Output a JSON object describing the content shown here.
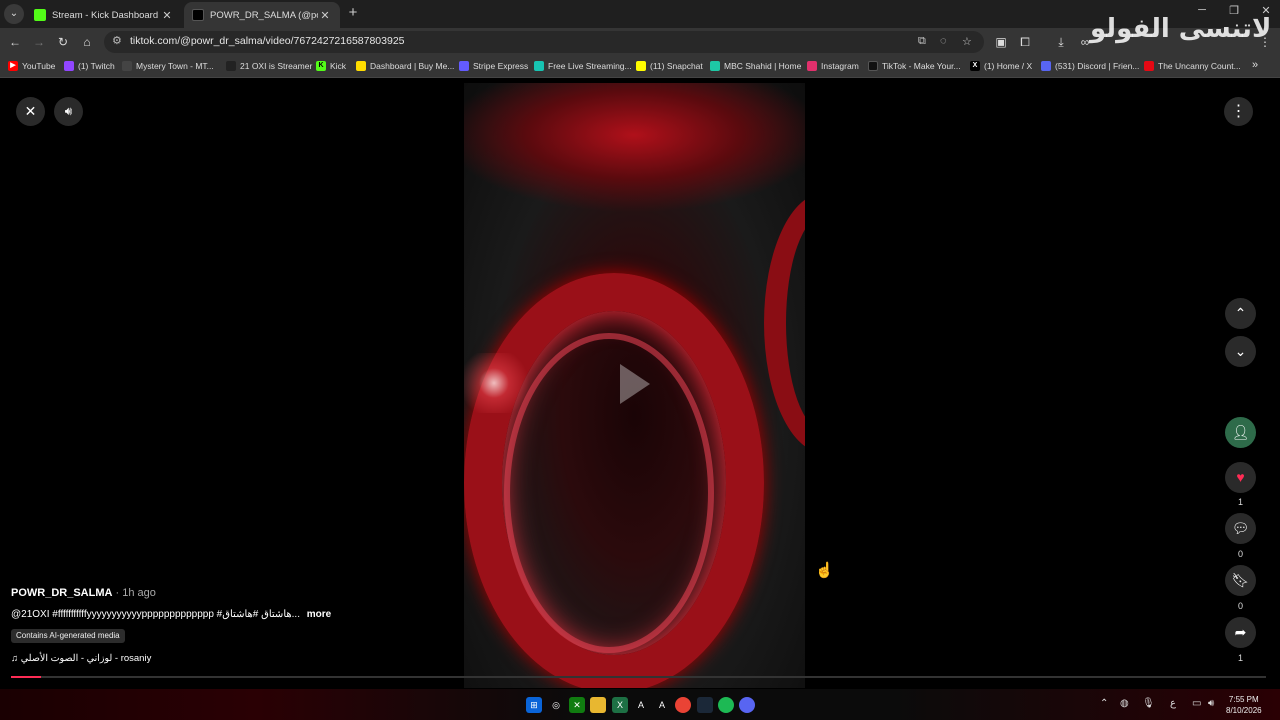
{
  "browser": {
    "tabs": [
      {
        "title": "Stream - Kick Dashboard",
        "favicon_color": "#53fc18",
        "active": false
      },
      {
        "title": "POWR_DR_SALMA (@powr_dr_",
        "favicon_color": "#000000",
        "active": true
      }
    ],
    "new_tab": "+",
    "url": "tiktok.com/@powr_dr_salma/video/7672427216587803925",
    "bookmarks": [
      {
        "label": "YouTube",
        "color": "#ff0000"
      },
      {
        "label": "(1) Twitch",
        "color": "#9146ff"
      },
      {
        "label": "Mystery Town - MT...",
        "color": "#444444"
      },
      {
        "label": "21 OXI is Streamer",
        "color": "#222222"
      },
      {
        "label": "Kick",
        "color": "#53fc18"
      },
      {
        "label": "Dashboard | Buy Me...",
        "color": "#ffdd00"
      },
      {
        "label": "Stripe Express",
        "color": "#635bff"
      },
      {
        "label": "Free Live Streaming...",
        "color": "#17c3b2"
      },
      {
        "label": "(11) Snapchat",
        "color": "#fffc00"
      },
      {
        "label": "MBC Shahid | Home",
        "color": "#1ec8a5"
      },
      {
        "label": "Instagram",
        "color": "#e1306c"
      },
      {
        "label": "TikTok - Make Your...",
        "color": "#111111"
      },
      {
        "label": "(1) Home / X",
        "color": "#000000"
      },
      {
        "label": "(531) Discord | Frien...",
        "color": "#5865f2"
      },
      {
        "label": "The Uncanny Count...",
        "color": "#e50914"
      }
    ],
    "bookmarks_overflow": "»"
  },
  "player": {
    "username": "POWR_DR_SALMA",
    "time_ago": " · 1h ago",
    "caption": "@21OXI #fffffffffffyyyyyyyyyyyppppppppppppp #هاشتاق #هاشتاق...",
    "more_label": "more",
    "ai_badge": "Contains AI-generated media",
    "music_icon": "♫",
    "music": "لوزاني - الصوت الأصلي - rosaniy",
    "progress": 0.01,
    "likes": "1",
    "comments": "0",
    "saves": "0",
    "shares": "1"
  },
  "watermark": "لاتنسى الفولو",
  "taskbar": {
    "time": "7:55 PM",
    "date": "8/10/2026",
    "lang": "ع"
  },
  "colors": {
    "accent_like": "#fe2c55",
    "ring_red": "#c0121b"
  }
}
